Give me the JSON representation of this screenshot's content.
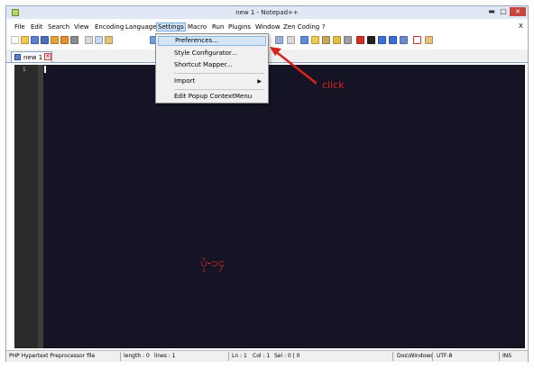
{
  "window": {
    "title": "new  1 - Notepad++",
    "minimize_glyph": "▬",
    "maximize_glyph": "□",
    "close_glyph": "✕"
  },
  "menubar": {
    "items": [
      "File",
      "Edit",
      "Search",
      "View",
      "Encoding",
      "Language",
      "Settings",
      "Macro",
      "Run",
      "Plugins",
      "Window",
      "Zen Coding",
      "?"
    ],
    "active": "Settings",
    "close_doc": "X"
  },
  "settings_menu": {
    "items": [
      {
        "label": "Preferences...",
        "highlighted": true
      },
      {
        "label": "Style Configurator...",
        "highlighted": false
      },
      {
        "label": "Shortcut Mapper...",
        "highlighted": false
      },
      {
        "label": "Import",
        "submenu": true,
        "highlighted": false
      },
      {
        "label": "Edit Popup ContextMenu",
        "highlighted": false
      }
    ],
    "submenu_glyph": "▶"
  },
  "tab": {
    "label": "new  1",
    "close_glyph": "×"
  },
  "editor": {
    "line_numbers": [
      "1"
    ],
    "watermark": "ပုံ-၁၄",
    "background": "#141424"
  },
  "annotation": {
    "text": "click",
    "color": "#d8231d"
  },
  "statusbar": {
    "file_type": "PHP Hypertext Preprocessor file",
    "length": "length : 0",
    "lines": "lines : 1",
    "ln": "Ln : 1",
    "col": "Col : 1",
    "sel": "Sel : 0 | 0",
    "eol": "Dos\\Windows",
    "encoding": "UTF-8",
    "mode": "INS"
  },
  "toolbar": {
    "icons": [
      "new-file-icon",
      "open-file-icon",
      "save-icon",
      "save-all-icon",
      "close-icon",
      "close-all-icon",
      "print-icon",
      "cut-icon",
      "copy-icon",
      "paste-icon",
      "undo-icon",
      "redo-icon",
      "find-icon",
      "replace-icon",
      "zoom-in-icon",
      "zoom-out-icon",
      "sync-v-icon",
      "sync-h-icon",
      "wrap-icon",
      "all-chars-icon",
      "indent-guide-icon",
      "lang-icon",
      "map-icon",
      "folder-icon",
      "func-list-icon",
      "record-icon",
      "stop-icon",
      "play-icon",
      "play-multi-icon",
      "save-macro-icon",
      "spell-check-icon",
      "extra-icon"
    ]
  }
}
